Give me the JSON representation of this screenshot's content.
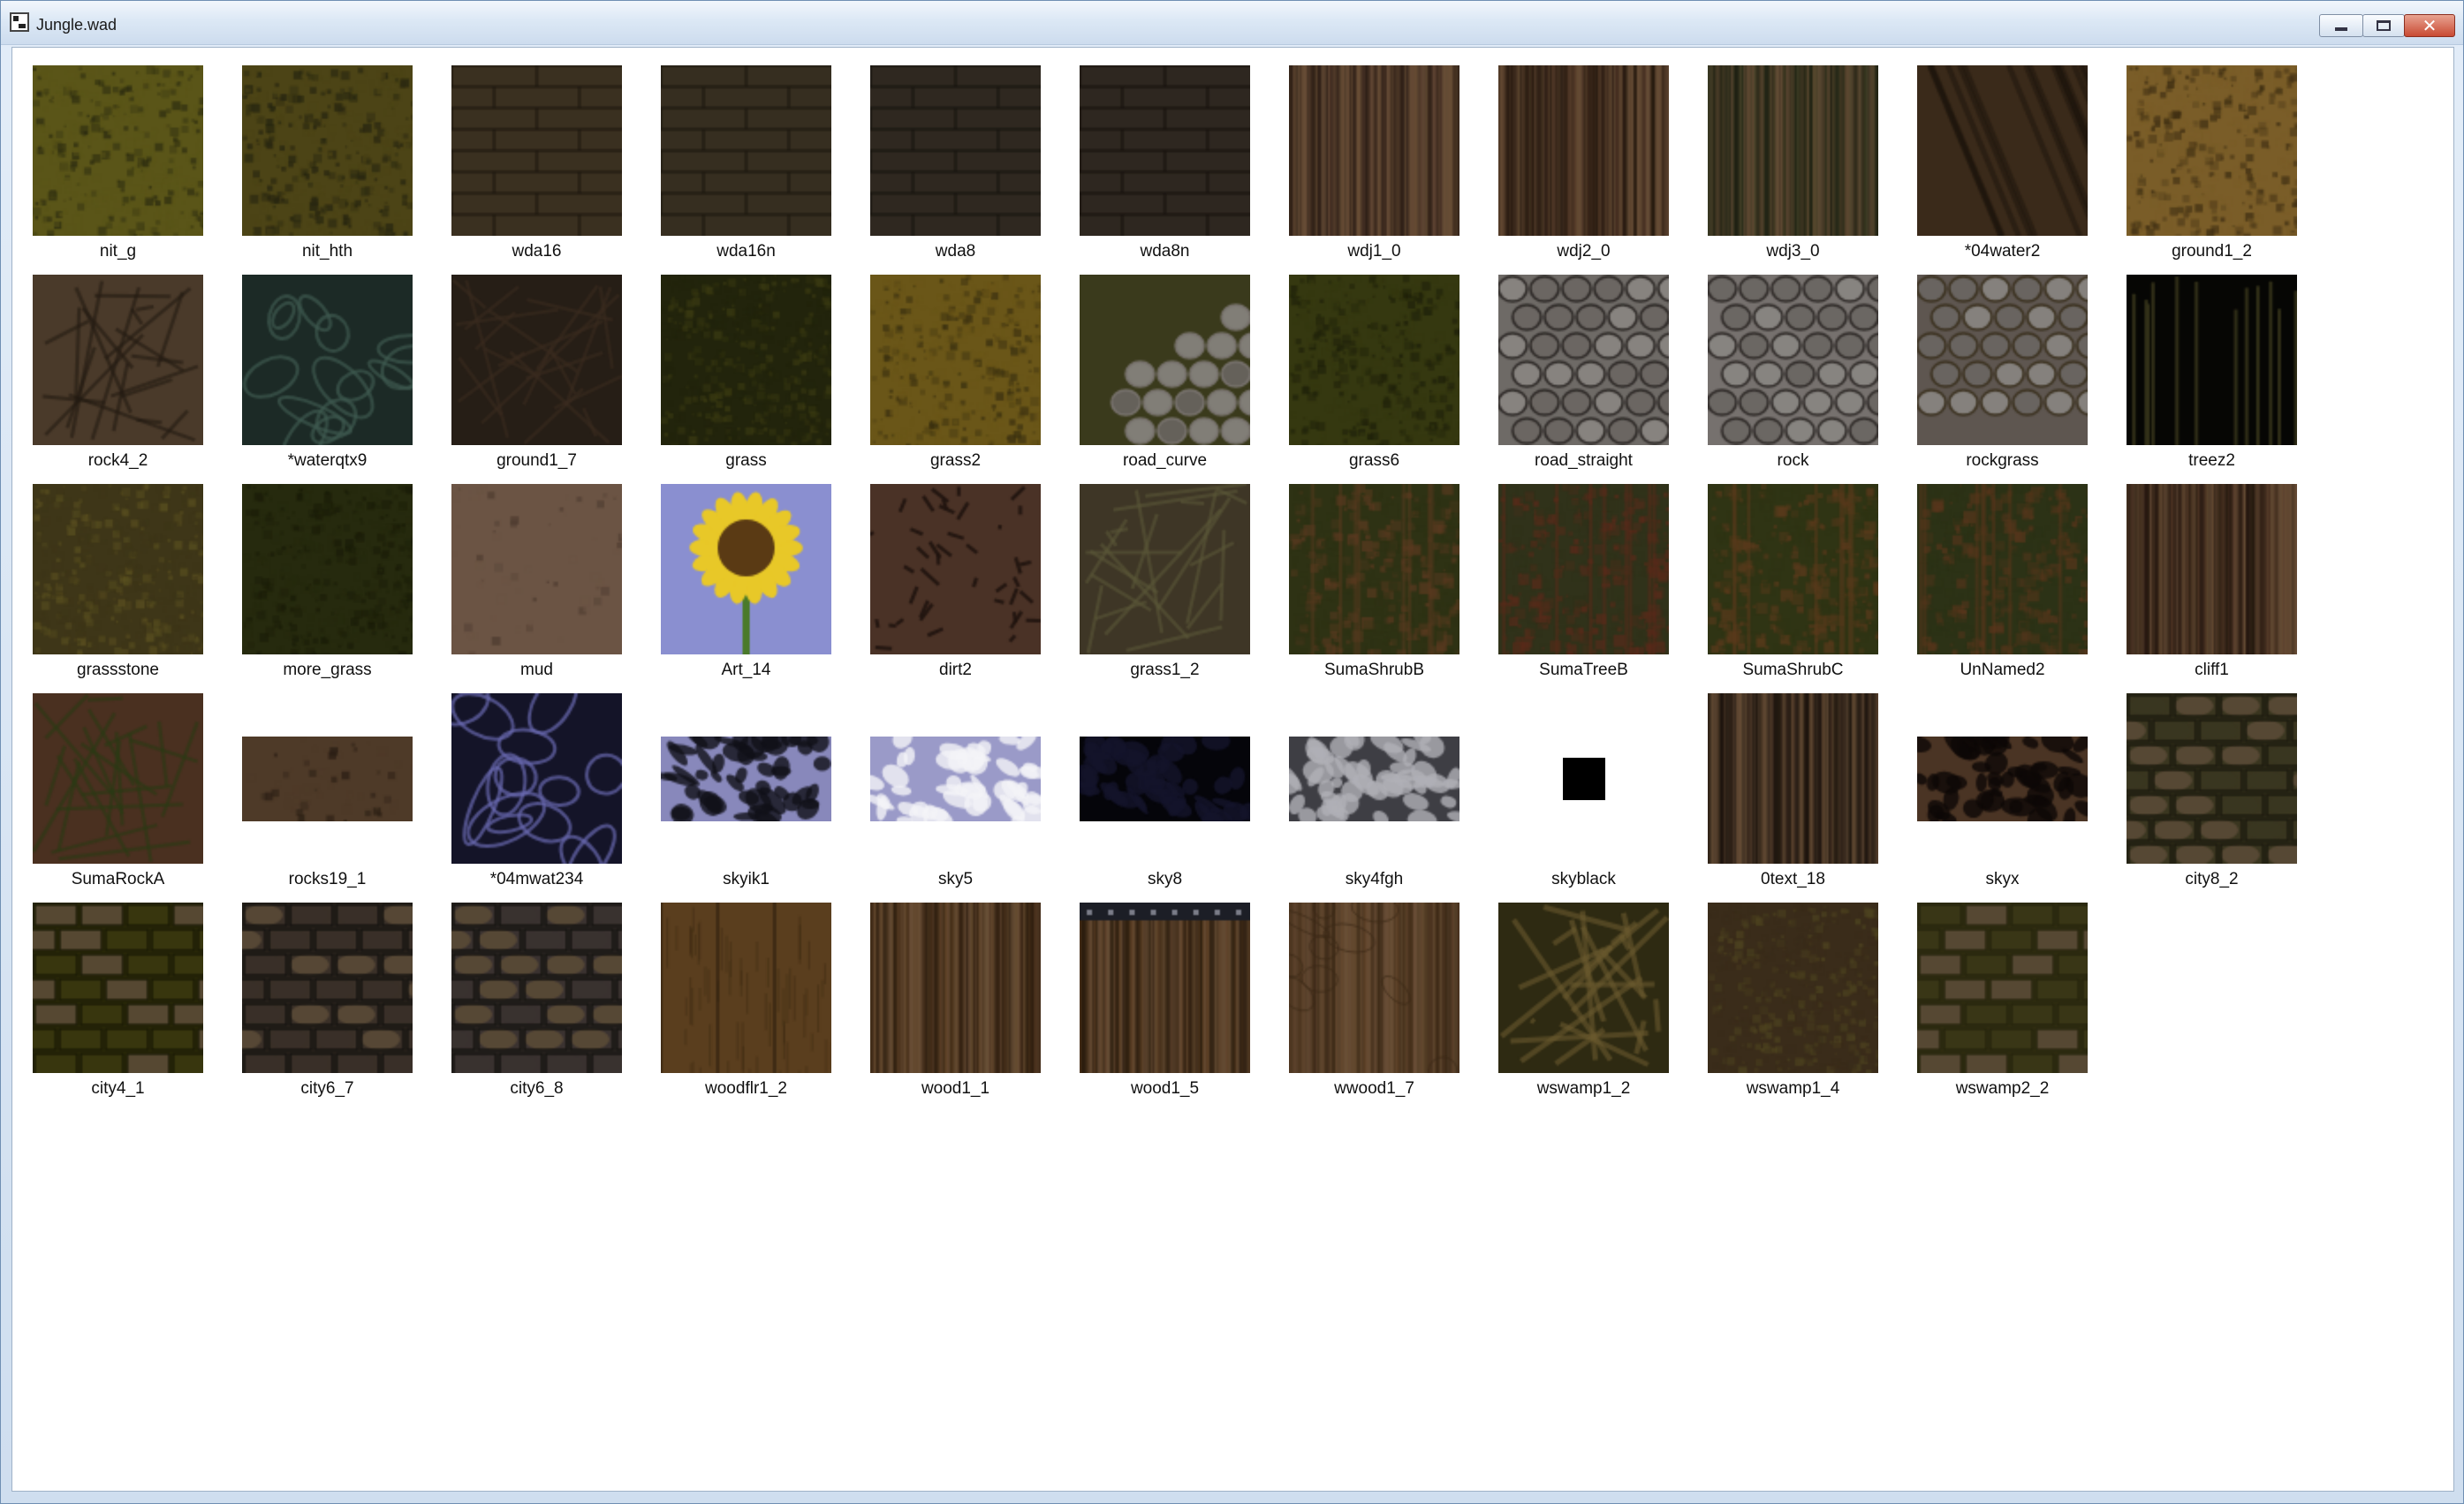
{
  "window": {
    "title": "Jungle.wad",
    "icon": "wad-file-icon",
    "controls": {
      "minimize": "minimize-icon",
      "maximize": "maximize-icon",
      "close": "close-icon"
    }
  },
  "textures": [
    {
      "name": "nit_g",
      "base": "#5a5518",
      "noise": "#2a2a10",
      "pattern": "moss",
      "shape": "square"
    },
    {
      "name": "nit_hth",
      "base": "#4c4416",
      "noise": "#252410",
      "pattern": "moss",
      "shape": "square"
    },
    {
      "name": "wda16",
      "base": "#3a3020",
      "noise": "#201a12",
      "pattern": "planks",
      "shape": "square"
    },
    {
      "name": "wda16n",
      "base": "#362e20",
      "noise": "#1e1912",
      "pattern": "planks",
      "shape": "square"
    },
    {
      "name": "wda8",
      "base": "#2f2820",
      "noise": "#1a1612",
      "pattern": "planks",
      "shape": "square"
    },
    {
      "name": "wda8n",
      "base": "#2e2720",
      "noise": "#191510",
      "pattern": "planks",
      "shape": "square"
    },
    {
      "name": "wdj1_0",
      "base": "#5a4030",
      "noise": "#2c1e16",
      "pattern": "grain",
      "shape": "square"
    },
    {
      "name": "wdj2_0",
      "base": "#4a3324",
      "noise": "#24180f",
      "pattern": "grain",
      "shape": "square"
    },
    {
      "name": "wdj3_0",
      "base": "#3b3b24",
      "noise": "#1d2012",
      "pattern": "grain",
      "shape": "square"
    },
    {
      "name": "*04water2",
      "base": "#3a2a1a",
      "noise": "#1c140c",
      "pattern": "streak",
      "shape": "square"
    },
    {
      "name": "ground1_2",
      "base": "#7a5d28",
      "noise": "#3d2d12",
      "pattern": "moss",
      "shape": "square"
    },
    {
      "name": "rock4_2",
      "base": "#4a3a2a",
      "noise": "#231a12",
      "pattern": "cross",
      "shape": "square"
    },
    {
      "name": "*waterqtx9",
      "base": "#1c2a26",
      "noise": "#3f5a50",
      "pattern": "swirl",
      "shape": "square"
    },
    {
      "name": "ground1_7",
      "base": "#261e16",
      "noise": "#3b2c1f",
      "pattern": "cross",
      "shape": "square"
    },
    {
      "name": "grass",
      "base": "#22240c",
      "noise": "#3a3a12",
      "pattern": "moss",
      "shape": "square"
    },
    {
      "name": "grass2",
      "base": "#6a5618",
      "noise": "#3a3010",
      "pattern": "moss",
      "shape": "square"
    },
    {
      "name": "road_curve",
      "base": "#3a3a1c",
      "noise": "#7a7470",
      "pattern": "cobbleCorner",
      "shape": "square"
    },
    {
      "name": "grass6",
      "base": "#353810",
      "noise": "#1e200a",
      "pattern": "moss",
      "shape": "square"
    },
    {
      "name": "road_straight",
      "base": "#6e6a66",
      "noise": "#2a2624",
      "pattern": "cobble",
      "shape": "square"
    },
    {
      "name": "rock",
      "base": "#76716e",
      "noise": "#2c2826",
      "pattern": "cobble",
      "shape": "square"
    },
    {
      "name": "rockgrass",
      "base": "#5e5650",
      "noise": "#3a301e",
      "pattern": "cobbleBottom",
      "shape": "square"
    },
    {
      "name": "treez2",
      "base": "#060604",
      "noise": "#34321a",
      "pattern": "stalks",
      "shape": "square"
    },
    {
      "name": "grassstone",
      "base": "#3e3618",
      "noise": "#5a5020",
      "pattern": "moss",
      "shape": "square"
    },
    {
      "name": "more_grass",
      "base": "#262a0e",
      "noise": "#1a1c08",
      "pattern": "moss",
      "shape": "square"
    },
    {
      "name": "mud",
      "base": "#6b5444",
      "noise": "#4e3c30",
      "pattern": "smooth",
      "shape": "square"
    },
    {
      "name": "Art_14",
      "base": "#8a8fd0",
      "noise": "#e8c828",
      "pattern": "sunflower",
      "shape": "square"
    },
    {
      "name": "dirt2",
      "base": "#4a3226",
      "noise": "#201410",
      "pattern": "cracks",
      "shape": "square"
    },
    {
      "name": "grass1_2",
      "base": "#3e3626",
      "noise": "#5c5838",
      "pattern": "cross",
      "shape": "square"
    },
    {
      "name": "SumaShrubB",
      "base": "#2e3214",
      "noise": "#5a3a20",
      "pattern": "shrub",
      "shape": "square"
    },
    {
      "name": "SumaTreeB",
      "base": "#30321a",
      "noise": "#5a2a1a",
      "pattern": "shrub",
      "shape": "square"
    },
    {
      "name": "SumaShrubC",
      "base": "#2f3414",
      "noise": "#5a3a1c",
      "pattern": "shrub",
      "shape": "square"
    },
    {
      "name": "UnNamed2",
      "base": "#2c3216",
      "noise": "#5a361c",
      "pattern": "shrub",
      "shape": "square"
    },
    {
      "name": "cliff1",
      "base": "#4a3222",
      "noise": "#241810",
      "pattern": "grain",
      "shape": "square"
    },
    {
      "name": "SumaRockA",
      "base": "#4a3020",
      "noise": "#2a3a14",
      "pattern": "cross",
      "shape": "square"
    },
    {
      "name": "rocks19_1",
      "base": "#4e3a28",
      "noise": "#2a1e14",
      "pattern": "smooth",
      "shape": "half"
    },
    {
      "name": "*04mwat234",
      "base": "#141428",
      "noise": "#6a6ab0",
      "pattern": "caustic",
      "shape": "square"
    },
    {
      "name": "skyik1",
      "base": "#8888bb",
      "noise": "#101018",
      "pattern": "clouds",
      "shape": "half"
    },
    {
      "name": "sky5",
      "base": "#9a9ac8",
      "noise": "#f4f4f8",
      "pattern": "clouds",
      "shape": "half"
    },
    {
      "name": "sky8",
      "base": "#05050a",
      "noise": "#14142a",
      "pattern": "clouds",
      "shape": "half"
    },
    {
      "name": "sky4fgh",
      "base": "#3e3e44",
      "noise": "#b0b0b6",
      "pattern": "clouds",
      "shape": "half"
    },
    {
      "name": "skyblack",
      "base": "#000000",
      "noise": "#000000",
      "pattern": "smooth",
      "shape": "small"
    },
    {
      "name": "0text_18",
      "base": "#3a2c20",
      "noise": "#1c140e",
      "pattern": "grain",
      "shape": "square"
    },
    {
      "name": "skyx",
      "base": "#4a3424",
      "noise": "#0c0806",
      "pattern": "clouds",
      "shape": "half"
    },
    {
      "name": "city8_2",
      "base": "#3a3620",
      "noise": "#1c1a0e",
      "pattern": "bricksRound",
      "shape": "square"
    },
    {
      "name": "city4_1",
      "base": "#38360e",
      "noise": "#1a1a06",
      "pattern": "bricks",
      "shape": "square"
    },
    {
      "name": "city6_7",
      "base": "#3a3028",
      "noise": "#141210",
      "pattern": "bricksRound",
      "shape": "square"
    },
    {
      "name": "city6_8",
      "base": "#3a3230",
      "noise": "#141210",
      "pattern": "bricksRound",
      "shape": "square"
    },
    {
      "name": "woodflr1_2",
      "base": "#5a3e1e",
      "noise": "#2e200e",
      "pattern": "boards",
      "shape": "square"
    },
    {
      "name": "wood1_1",
      "base": "#5c4024",
      "noise": "#2e1e10",
      "pattern": "grain",
      "shape": "square"
    },
    {
      "name": "wood1_5",
      "base": "#5a3e24",
      "noise": "#2c1e10",
      "pattern": "grainStrip",
      "shape": "square"
    },
    {
      "name": "wwood1_7",
      "base": "#5e4228",
      "noise": "#3a2816",
      "pattern": "knots",
      "shape": "square"
    },
    {
      "name": "wswamp1_2",
      "base": "#2e2a12",
      "noise": "#6a5a2e",
      "pattern": "vines",
      "shape": "square"
    },
    {
      "name": "wswamp1_4",
      "base": "#3a2c1a",
      "noise": "#4e4420",
      "pattern": "moss",
      "shape": "square"
    },
    {
      "name": "wswamp2_2",
      "base": "#3a3616",
      "noise": "#26240c",
      "pattern": "bricks",
      "shape": "square"
    }
  ]
}
